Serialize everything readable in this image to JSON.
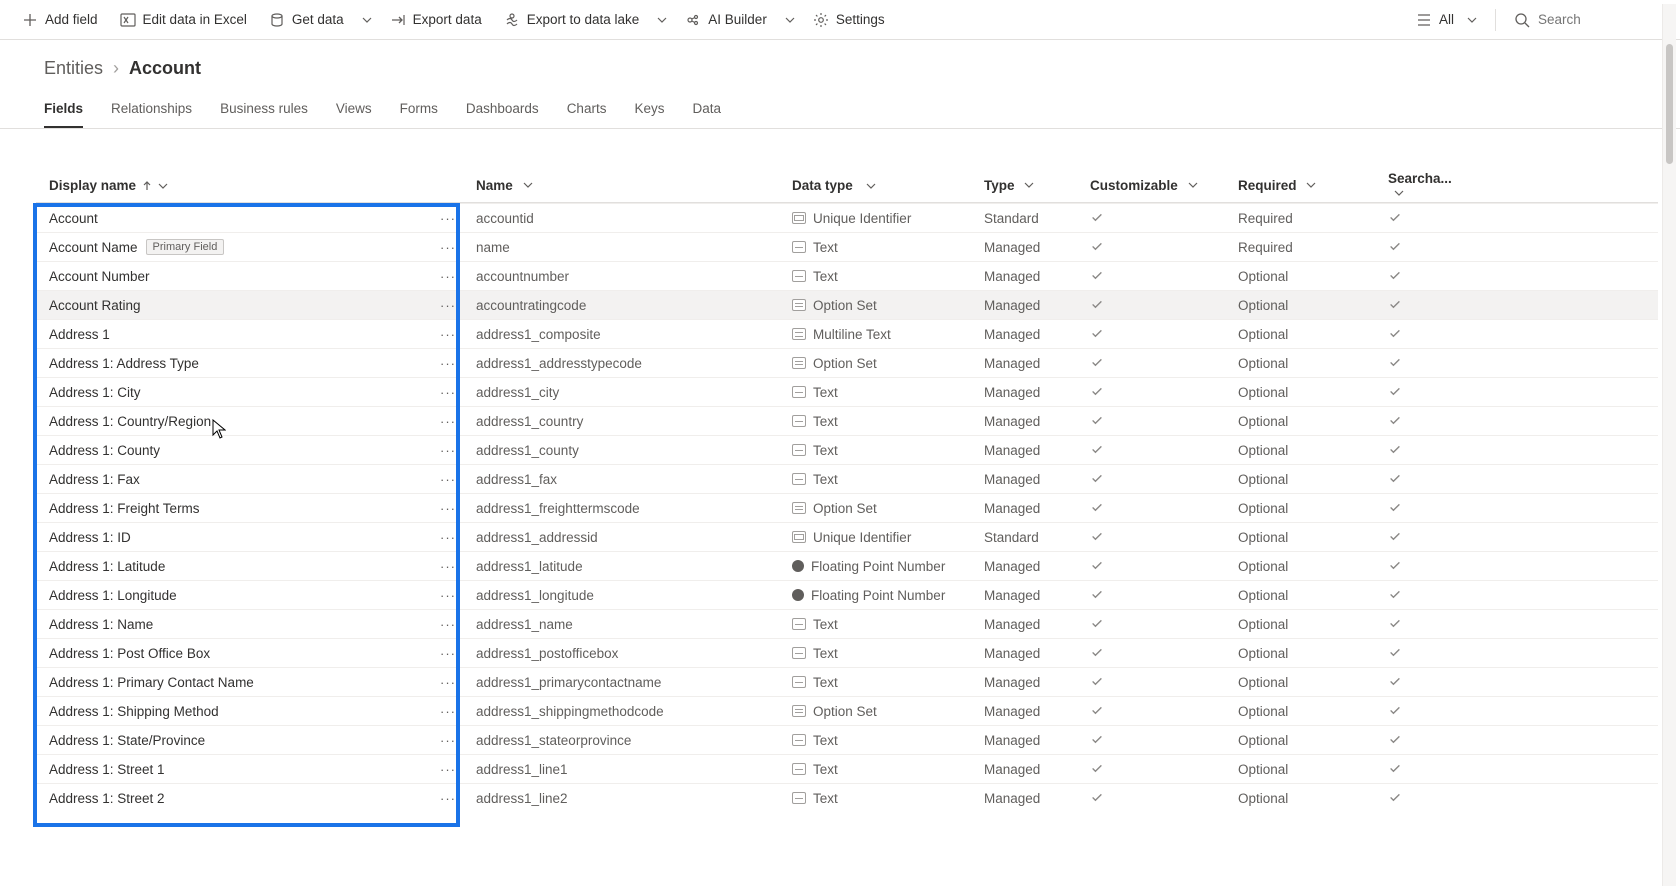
{
  "commandBar": {
    "left": [
      {
        "id": "add-field",
        "label": "Add field",
        "icon": "plus"
      },
      {
        "id": "edit-excel",
        "label": "Edit data in Excel",
        "icon": "excel"
      },
      {
        "id": "get-data",
        "label": "Get data",
        "icon": "db",
        "caret": true
      },
      {
        "id": "export-data",
        "label": "Export data",
        "icon": "export"
      },
      {
        "id": "export-lake",
        "label": "Export to data lake",
        "icon": "lake",
        "caret": true
      },
      {
        "id": "ai-builder",
        "label": "AI Builder",
        "icon": "ai",
        "caret": true
      },
      {
        "id": "settings",
        "label": "Settings",
        "icon": "gear"
      }
    ],
    "viewFilter": "All",
    "searchPlaceholder": "Search"
  },
  "breadcrumb": {
    "parent": "Entities",
    "current": "Account"
  },
  "tabs": [
    "Fields",
    "Relationships",
    "Business rules",
    "Views",
    "Forms",
    "Dashboards",
    "Charts",
    "Keys",
    "Data"
  ],
  "activeTab": "Fields",
  "columns": {
    "display": "Display name",
    "name": "Name",
    "dtype": "Data type",
    "type": "Type",
    "cust": "Customizable",
    "req": "Required",
    "search": "Searcha..."
  },
  "rows": [
    {
      "display": "Account",
      "name": "accountid",
      "dtype": "Unique Identifier",
      "dticon": "uid",
      "type": "Standard",
      "cust": true,
      "req": "Required",
      "search": true,
      "primary": false
    },
    {
      "display": "Account Name",
      "name": "name",
      "dtype": "Text",
      "dticon": "txt",
      "type": "Managed",
      "cust": true,
      "req": "Required",
      "search": true,
      "primary": true
    },
    {
      "display": "Account Number",
      "name": "accountnumber",
      "dtype": "Text",
      "dticon": "txt",
      "type": "Managed",
      "cust": true,
      "req": "Optional",
      "search": true,
      "primary": false
    },
    {
      "display": "Account Rating",
      "name": "accountratingcode",
      "dtype": "Option Set",
      "dticon": "opt",
      "type": "Managed",
      "cust": true,
      "req": "Optional",
      "search": true,
      "primary": false,
      "hover": true
    },
    {
      "display": "Address 1",
      "name": "address1_composite",
      "dtype": "Multiline Text",
      "dticon": "ml",
      "type": "Managed",
      "cust": true,
      "req": "Optional",
      "search": true,
      "primary": false
    },
    {
      "display": "Address 1: Address Type",
      "name": "address1_addresstypecode",
      "dtype": "Option Set",
      "dticon": "opt",
      "type": "Managed",
      "cust": true,
      "req": "Optional",
      "search": true,
      "primary": false
    },
    {
      "display": "Address 1: City",
      "name": "address1_city",
      "dtype": "Text",
      "dticon": "txt",
      "type": "Managed",
      "cust": true,
      "req": "Optional",
      "search": true,
      "primary": false
    },
    {
      "display": "Address 1: Country/Region",
      "name": "address1_country",
      "dtype": "Text",
      "dticon": "txt",
      "type": "Managed",
      "cust": true,
      "req": "Optional",
      "search": true,
      "primary": false
    },
    {
      "display": "Address 1: County",
      "name": "address1_county",
      "dtype": "Text",
      "dticon": "txt",
      "type": "Managed",
      "cust": true,
      "req": "Optional",
      "search": true,
      "primary": false
    },
    {
      "display": "Address 1: Fax",
      "name": "address1_fax",
      "dtype": "Text",
      "dticon": "txt",
      "type": "Managed",
      "cust": true,
      "req": "Optional",
      "search": true,
      "primary": false
    },
    {
      "display": "Address 1: Freight Terms",
      "name": "address1_freighttermscode",
      "dtype": "Option Set",
      "dticon": "opt",
      "type": "Managed",
      "cust": true,
      "req": "Optional",
      "search": true,
      "primary": false
    },
    {
      "display": "Address 1: ID",
      "name": "address1_addressid",
      "dtype": "Unique Identifier",
      "dticon": "uid",
      "type": "Standard",
      "cust": true,
      "req": "Optional",
      "search": true,
      "primary": false
    },
    {
      "display": "Address 1: Latitude",
      "name": "address1_latitude",
      "dtype": "Floating Point Number",
      "dticon": "float",
      "type": "Managed",
      "cust": true,
      "req": "Optional",
      "search": true,
      "primary": false
    },
    {
      "display": "Address 1: Longitude",
      "name": "address1_longitude",
      "dtype": "Floating Point Number",
      "dticon": "float",
      "type": "Managed",
      "cust": true,
      "req": "Optional",
      "search": true,
      "primary": false
    },
    {
      "display": "Address 1: Name",
      "name": "address1_name",
      "dtype": "Text",
      "dticon": "txt",
      "type": "Managed",
      "cust": true,
      "req": "Optional",
      "search": true,
      "primary": false
    },
    {
      "display": "Address 1: Post Office Box",
      "name": "address1_postofficebox",
      "dtype": "Text",
      "dticon": "txt",
      "type": "Managed",
      "cust": true,
      "req": "Optional",
      "search": true,
      "primary": false
    },
    {
      "display": "Address 1: Primary Contact Name",
      "name": "address1_primarycontactname",
      "dtype": "Text",
      "dticon": "txt",
      "type": "Managed",
      "cust": true,
      "req": "Optional",
      "search": true,
      "primary": false
    },
    {
      "display": "Address 1: Shipping Method",
      "name": "address1_shippingmethodcode",
      "dtype": "Option Set",
      "dticon": "opt",
      "type": "Managed",
      "cust": true,
      "req": "Optional",
      "search": true,
      "primary": false
    },
    {
      "display": "Address 1: State/Province",
      "name": "address1_stateorprovince",
      "dtype": "Text",
      "dticon": "txt",
      "type": "Managed",
      "cust": true,
      "req": "Optional",
      "search": true,
      "primary": false
    },
    {
      "display": "Address 1: Street 1",
      "name": "address1_line1",
      "dtype": "Text",
      "dticon": "txt",
      "type": "Managed",
      "cust": true,
      "req": "Optional",
      "search": true,
      "primary": false
    },
    {
      "display": "Address 1: Street 2",
      "name": "address1_line2",
      "dtype": "Text",
      "dticon": "txt",
      "type": "Managed",
      "cust": true,
      "req": "Optional",
      "search": true,
      "primary": false
    }
  ],
  "primaryTag": "Primary Field"
}
